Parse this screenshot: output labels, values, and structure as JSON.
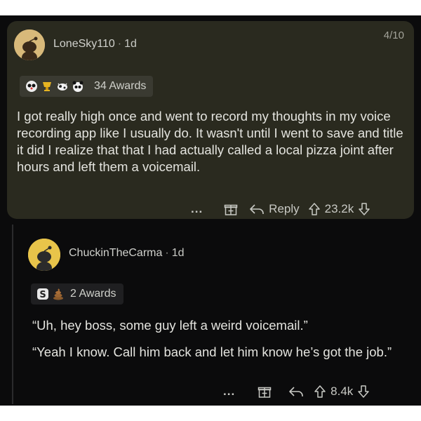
{
  "post": {
    "page_counter": "4/10",
    "author": "LoneSky110",
    "age": "1d",
    "awards_count": "34 Awards",
    "award_icons": [
      "panda-award-icon",
      "trophy-award-icon",
      "cow-award-icon",
      "panda-face-award-icon"
    ],
    "text": "I got really high once and went to record my thoughts in my voice recording app like I usually do. It wasn't until I went to save and title it did I realize that that I had actually called a local pizza joint after hours and left them a voicemail.",
    "actions": {
      "more": "...",
      "reply_label": "Reply",
      "score": "23.2k"
    }
  },
  "reply": {
    "author": "ChuckinTheCarma",
    "age": "1d",
    "awards_count": "2 Awards",
    "award_icons": [
      "silver-award-icon",
      "poop-award-icon"
    ],
    "paragraphs": [
      "“Uh, hey boss, some guy left a weird voicemail.”",
      "“Yeah I know. Call him back and let him know he’s got the job.”"
    ],
    "actions": {
      "more": "...",
      "score": "8.4k"
    }
  },
  "colors": {
    "screen_bg": "#0b0b0c",
    "post_bg": "#2a2a1f",
    "avatar_bg": "#d8b97a",
    "reply_avatar_bg": "#e8c44a"
  }
}
